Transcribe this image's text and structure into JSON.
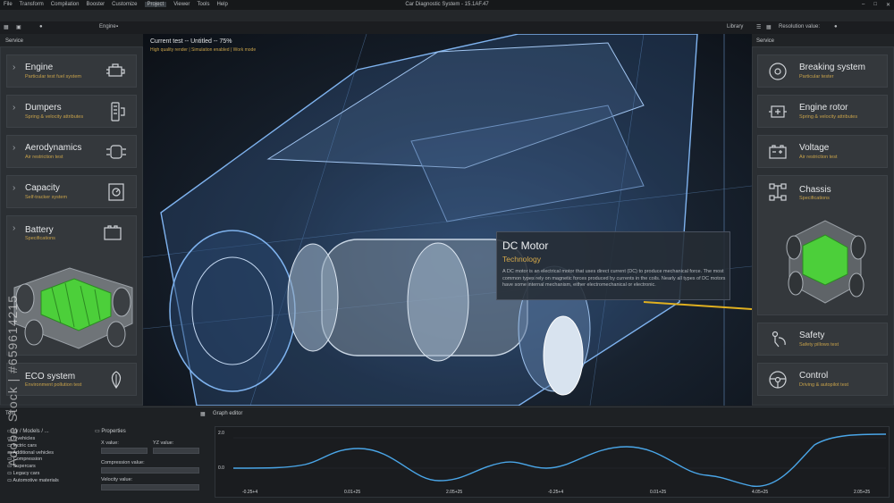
{
  "window": {
    "title": "Car Diagnostic System - 15.1AF.47",
    "menu": [
      "File",
      "Transform",
      "Compilation",
      "Booster",
      "Customize",
      "Project",
      "Viewer",
      "Tools",
      "Help"
    ],
    "active_menu": "Project"
  },
  "toolbar": {
    "engine_label": "Engine",
    "library_label": "Library",
    "resolution_label": "Resolution value:"
  },
  "left_panel": {
    "title": "Service",
    "items": [
      {
        "title": "Engine",
        "subtitle": "Particular test fuel system",
        "icon": "engine-icon"
      },
      {
        "title": "Dumpers",
        "subtitle": "Spring & velocity attributes",
        "icon": "shock-absorber-icon"
      },
      {
        "title": "Aerodynamics",
        "subtitle": "Air restriction test",
        "icon": "car-aero-icon"
      },
      {
        "title": "Capacity",
        "subtitle": "Self-tracker system",
        "icon": "capacity-icon"
      },
      {
        "title": "Battery",
        "subtitle": "Specifications",
        "icon": "battery-icon"
      },
      {
        "title": "ECO system",
        "subtitle": "Environment pollution test",
        "icon": "eco-leaf-icon"
      }
    ]
  },
  "right_panel": {
    "title": "Service",
    "items": [
      {
        "title": "Breaking system",
        "subtitle": "Particular tester",
        "icon": "brake-disc-icon"
      },
      {
        "title": "Engine rotor",
        "subtitle": "Spring & velocity attributes",
        "icon": "rotor-icon"
      },
      {
        "title": "Voltage",
        "subtitle": "Air restriction test",
        "icon": "car-battery-icon"
      },
      {
        "title": "Chassis",
        "subtitle": "Specifications",
        "icon": "chassis-icon"
      },
      {
        "title": "Safety",
        "subtitle": "Safety pillows test",
        "icon": "airbag-icon"
      },
      {
        "title": "Control",
        "subtitle": "Driving & autopilot test",
        "icon": "steering-wheel-icon"
      }
    ]
  },
  "viewport": {
    "header": "Current test -- Untitled -- 75%",
    "subheader": "High quality render | Simulation enabled | Work mode"
  },
  "popup": {
    "title": "DC Motor",
    "subtitle": "Technology",
    "body": "A DC motor is an electrical motor that uses direct current (DC) to produce mechanical force. The most common types rely on magnetic forces produced by currents in the coils. Nearly all types of DC motors have some internal mechanism, either electromechanical or electronic."
  },
  "bottom": {
    "left_tab": "Tem",
    "graph_tab": "Graph editor",
    "tree": {
      "path": "ry / Models / ...",
      "items": [
        "n vehicles",
        "lectric cars",
        "Additional vehicles",
        "Compression",
        "Supercars",
        "Legacy cars",
        "Automotive materials"
      ]
    },
    "properties": {
      "title": "Properties",
      "x_label": "X value:",
      "yz_label": "YZ value:",
      "compression_label": "Compression value:",
      "velocity_label": "Velocity value:"
    },
    "graph": {
      "y_top": "2.0",
      "y_mid": "0.0",
      "x_ticks": [
        "-0.25+4",
        "0.01+25",
        "2.05+25",
        "-0.25+4",
        "0.01+25",
        "4.05+25",
        "2.05+25"
      ]
    }
  },
  "watermark": "Adobe Stock | #659614215",
  "colors": {
    "accent": "#c8a24a",
    "curve": "#4aa6e8",
    "battery": "#4ccf3a"
  }
}
